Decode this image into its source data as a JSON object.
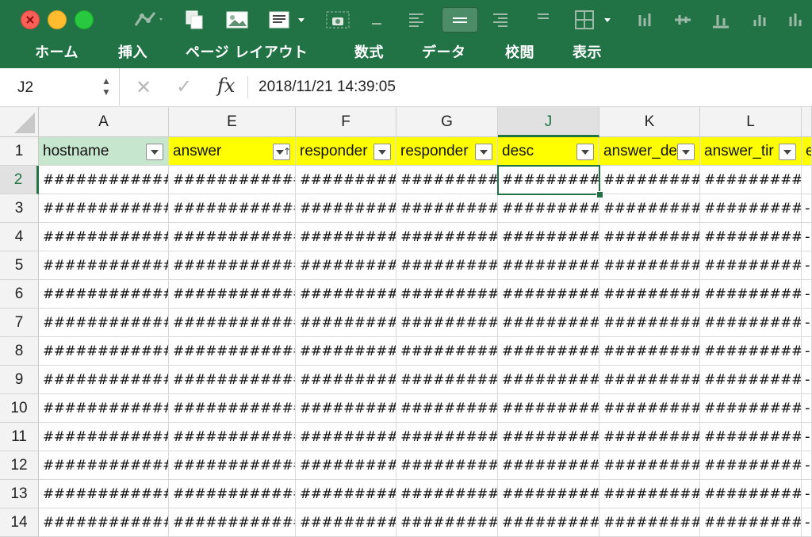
{
  "window": {
    "toolbar_icons": [
      "chart-icon",
      "copy-icon",
      "picture-icon",
      "text-box-icon",
      "camera-icon",
      "align-left-icon",
      "align-center-icon",
      "align-right-icon",
      "borders-icon"
    ]
  },
  "ribbon": {
    "tabs": [
      "ホーム",
      "挿入",
      "ページ レイアウト",
      "数式",
      "データ",
      "校閲",
      "表示"
    ]
  },
  "formula_bar": {
    "name_box": "J2",
    "fx_label": "fx",
    "value": "2018/11/21  14:39:05"
  },
  "sheet": {
    "columns": [
      "A",
      "E",
      "F",
      "G",
      "J",
      "K",
      "L"
    ],
    "active_column": "J",
    "active_row": "2",
    "header_cells": [
      "hostname",
      "answer",
      "responder",
      "responder",
      "desc",
      "answer_de",
      "answer_tir",
      "e"
    ],
    "rows": [
      {
        "num": "2",
        "cells": [
          "############",
          "############",
          "#########",
          "#########",
          "##########",
          "#########",
          "#########"
        ]
      },
      {
        "num": "3",
        "cells": [
          "############",
          "############",
          "#########",
          "#########",
          "##########",
          "#########",
          "#########"
        ]
      },
      {
        "num": "4",
        "cells": [
          "############",
          "############",
          "#########",
          "#########",
          "##########",
          "#########",
          "#########"
        ]
      },
      {
        "num": "5",
        "cells": [
          "############",
          "############",
          "#########",
          "#########",
          "##########",
          "#########",
          "#########"
        ]
      },
      {
        "num": "6",
        "cells": [
          "############",
          "############",
          "#########",
          "#########",
          "##########",
          "#########",
          "#########"
        ]
      },
      {
        "num": "7",
        "cells": [
          "############",
          "############",
          "#########",
          "#########",
          "##########",
          "#########",
          "#########"
        ]
      },
      {
        "num": "8",
        "cells": [
          "############",
          "############",
          "#########",
          "#########",
          "##########",
          "#########",
          "#########"
        ]
      },
      {
        "num": "9",
        "cells": [
          "############",
          "############",
          "#########",
          "#########",
          "##########",
          "#########",
          "#########"
        ]
      },
      {
        "num": "10",
        "cells": [
          "############",
          "############",
          "#########",
          "#########",
          "##########",
          "#########",
          "#########"
        ]
      },
      {
        "num": "11",
        "cells": [
          "############",
          "############",
          "#########",
          "#########",
          "##########",
          "#########",
          "#########"
        ]
      },
      {
        "num": "12",
        "cells": [
          "############",
          "############",
          "#########",
          "#########",
          "##########",
          "#########",
          "#########"
        ]
      },
      {
        "num": "13",
        "cells": [
          "############",
          "############",
          "#########",
          "#########",
          "##########",
          "#########",
          "#########"
        ]
      },
      {
        "num": "14",
        "cells": [
          "############",
          "############",
          "#########",
          "#########",
          "##########",
          "#########",
          "#########"
        ]
      }
    ],
    "colors": {
      "accent": "#217346",
      "header_yellow": "#ffff00",
      "hostname_fill": "#c6e6cd"
    }
  }
}
